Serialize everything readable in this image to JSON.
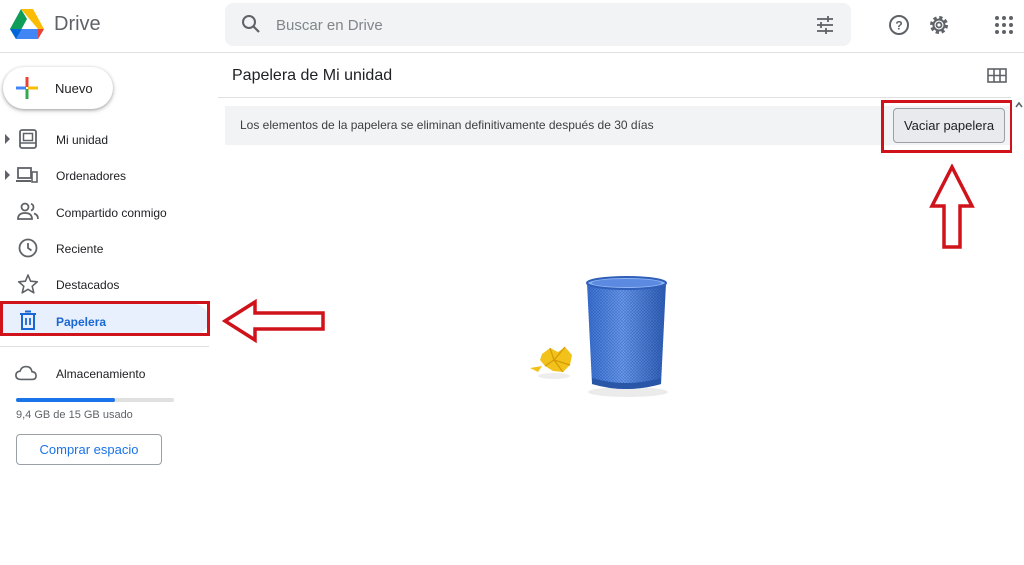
{
  "header": {
    "brand": "Drive",
    "search_placeholder": "Buscar en Drive"
  },
  "sidebar": {
    "new_label": "Nuevo",
    "items": [
      {
        "label": "Mi unidad",
        "icon": "my-drive-icon"
      },
      {
        "label": "Ordenadores",
        "icon": "computers-icon"
      },
      {
        "label": "Compartido conmigo",
        "icon": "shared-icon"
      },
      {
        "label": "Reciente",
        "icon": "clock-icon"
      },
      {
        "label": "Destacados",
        "icon": "star-icon"
      },
      {
        "label": "Papelera",
        "icon": "trash-icon",
        "active": true
      }
    ],
    "storage_label": "Almacenamiento",
    "storage_usage": "9,4 GB de 15 GB usado",
    "storage_fraction": 0.627,
    "buy_label": "Comprar espacio"
  },
  "main": {
    "title": "Papelera de Mi unidad",
    "banner_text": "Los elementos de la papelera se eliminan definitivamente después de 30 días",
    "empty_button": "Vaciar papelera"
  },
  "colors": {
    "accent": "#1a73e8",
    "active_bg": "#e8f0fe",
    "annotation_red": "#d0121b"
  }
}
